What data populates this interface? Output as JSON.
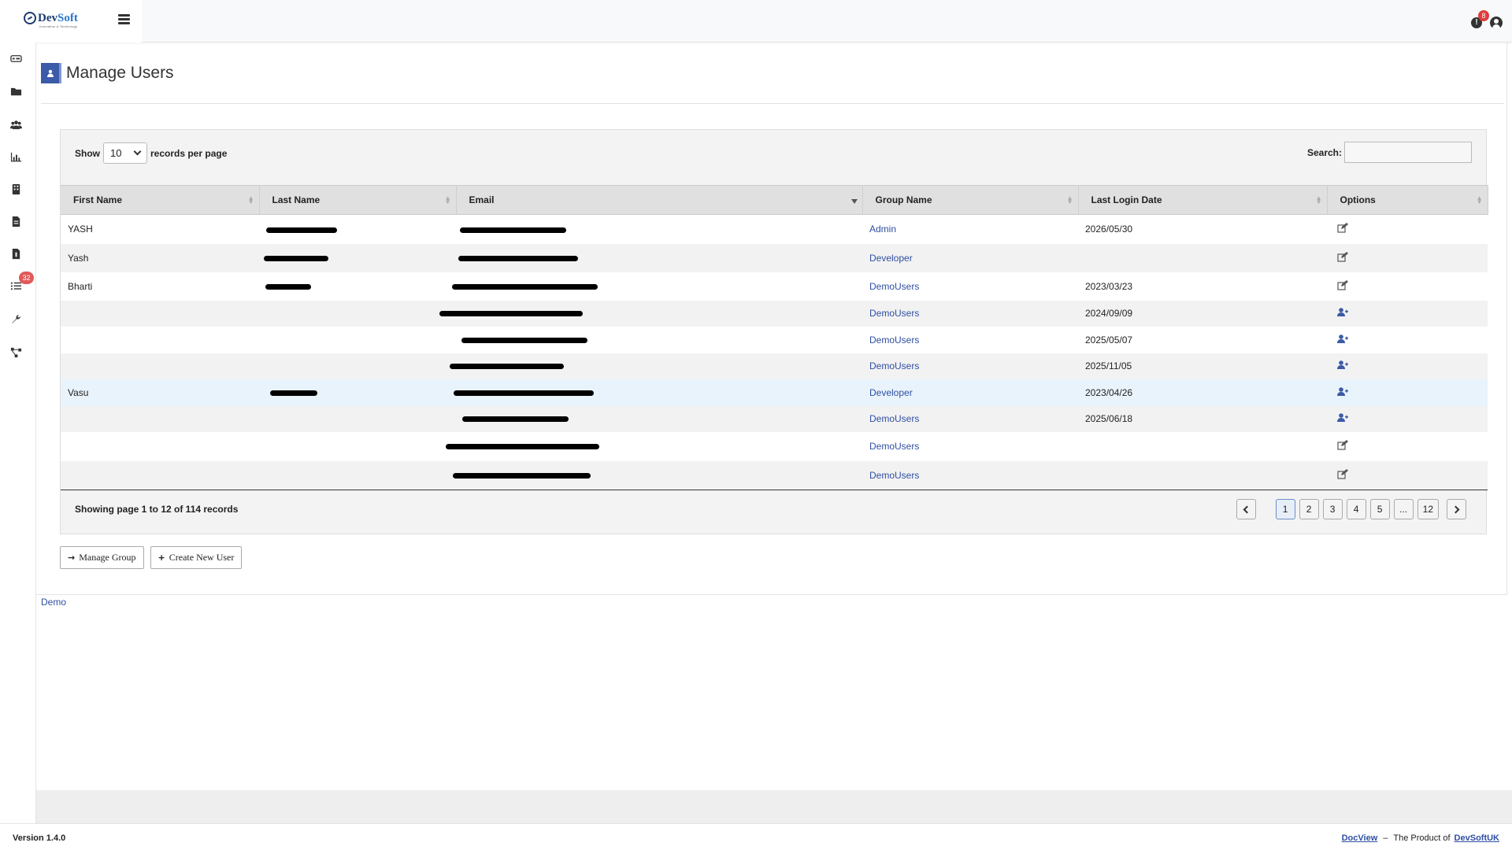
{
  "header": {
    "logo_dev": "Dev",
    "logo_soft": "Soft",
    "logo_tagline": "Innovation & Technology",
    "alert_count": "8"
  },
  "sidebar": {
    "items": [
      {
        "icon": "dashboard-icon"
      },
      {
        "icon": "folder-icon"
      },
      {
        "icon": "users-icon"
      },
      {
        "icon": "bar-chart-icon"
      },
      {
        "icon": "building-icon"
      },
      {
        "icon": "document-icon"
      },
      {
        "icon": "report-icon"
      },
      {
        "icon": "task-list-icon",
        "badge": "32"
      },
      {
        "icon": "wrench-icon"
      },
      {
        "icon": "workflow-icon"
      }
    ]
  },
  "page": {
    "title": "Manage Users"
  },
  "table_controls": {
    "show_label": "Show",
    "page_size": "10",
    "records_per_page_label": "records per page",
    "search_label": "Search:",
    "search_value": ""
  },
  "table": {
    "columns": [
      "First Name",
      "Last Name",
      "Email",
      "Group Name",
      "Last Login Date",
      "Options"
    ],
    "rows": [
      {
        "first_name": "YASH",
        "group": "Admin",
        "last_login": "2026/05/30",
        "option": "edit"
      },
      {
        "first_name": "Yash",
        "group": "Developer",
        "last_login": "",
        "option": "edit"
      },
      {
        "first_name": "Bharti",
        "group": "DemoUsers",
        "last_login": "2023/03/23",
        "option": "edit"
      },
      {
        "first_name": "",
        "group": "DemoUsers",
        "last_login": "2024/09/09",
        "option": "add-user"
      },
      {
        "first_name": "",
        "group": "DemoUsers",
        "last_login": "2025/05/07",
        "option": "add-user"
      },
      {
        "first_name": "",
        "group": "DemoUsers",
        "last_login": "2025/11/05",
        "option": "add-user"
      },
      {
        "first_name": "Vasu",
        "group": "Developer",
        "last_login": "2023/04/26",
        "option": "add-user"
      },
      {
        "first_name": "",
        "group": "DemoUsers",
        "last_login": "2025/06/18",
        "option": "add-user"
      },
      {
        "first_name": "",
        "group": "DemoUsers",
        "last_login": "",
        "option": "edit"
      },
      {
        "first_name": "",
        "group": "DemoUsers",
        "last_login": "",
        "option": "edit"
      }
    ]
  },
  "pagination": {
    "summary": "Showing page 1 to 12 of 114 records",
    "pages": [
      "1",
      "2",
      "3",
      "4",
      "5",
      "...",
      "12"
    ],
    "active_page": "1"
  },
  "actions": {
    "manage_group": "Manage Group",
    "create_user": "Create New User"
  },
  "demo_link": "Demo",
  "footer": {
    "version": "Version 1.4.0",
    "product_link": "DocView",
    "dash": "–",
    "product_text": "The Product of",
    "company_link": "DevSoftUK"
  },
  "colors": {
    "accent": "#3b5aa7",
    "link": "#2f4fa3",
    "badge": "#e03b3b"
  }
}
